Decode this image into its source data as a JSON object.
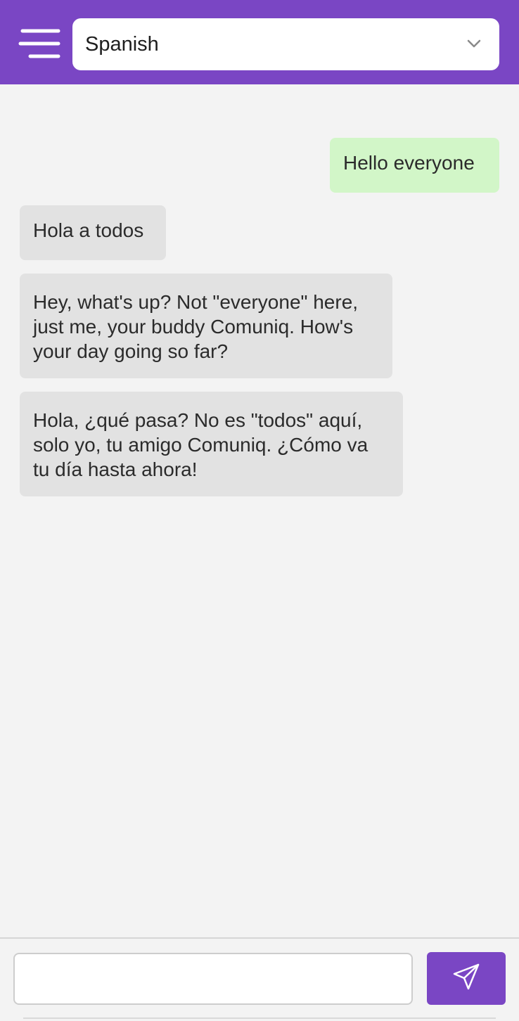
{
  "header": {
    "menu_icon": "hamburger-menu-icon",
    "language_select": {
      "value": "Spanish",
      "icon": "chevron-down-icon"
    }
  },
  "messages": [
    {
      "direction": "sent",
      "text": "Hello everyone"
    },
    {
      "direction": "received",
      "text": "Hola a todos"
    },
    {
      "direction": "received",
      "text": "Hey, what's up? Not \"everyone\" here, just me, your buddy Comuniq. How's your day going so far?"
    },
    {
      "direction": "received",
      "text": "Hola, ¿qué pasa? No es \"todos\" aquí, solo yo, tu amigo Comuniq. ¿Cómo va tu día hasta ahora!"
    }
  ],
  "composer": {
    "input_value": "",
    "input_placeholder": "",
    "send_icon": "send-paper-plane-icon"
  },
  "colors": {
    "accent": "#7a46c4",
    "sent_bubble": "#d2f6c8",
    "received_bubble": "#e2e2e2",
    "background": "#f3f3f3"
  }
}
